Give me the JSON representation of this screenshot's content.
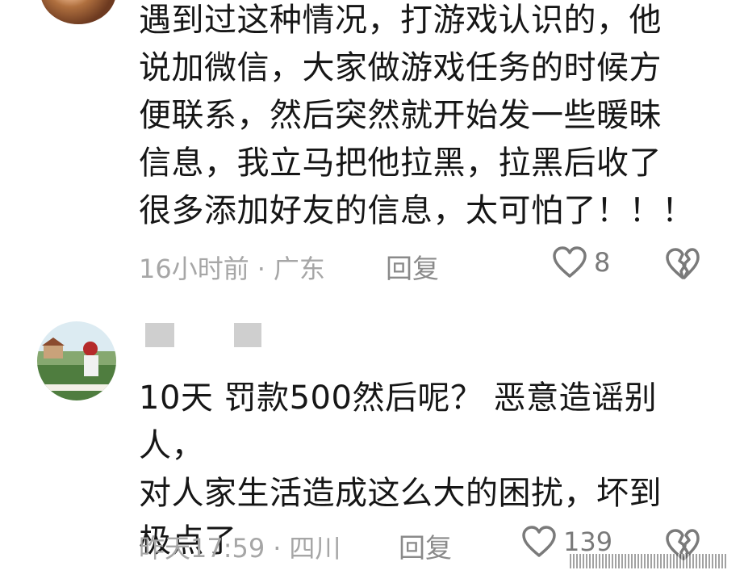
{
  "comments": [
    {
      "text_lines": [
        "遇到过这种情况，打游戏认识的，他",
        "说加微信，大家做游戏任务的时候方",
        "便联系，然后突然就开始发一些暖昧",
        "信息，我立马把他拉黑，拉黑后收了",
        "很多添加好友的信息，太可怕了！！！"
      ],
      "time": "16小时前",
      "separator": "·",
      "location": "广东",
      "reply_label": "回复",
      "likes": "8",
      "icons": {
        "like": "heart-outline-icon",
        "dislike": "broken-heart-icon"
      }
    },
    {
      "text_lines": [
        "10天 罚款500然后呢？ 恶意造谣别人，",
        "对人家生活造成这么大的困扰，坏到",
        "极点了"
      ],
      "time": "昨天17:59",
      "separator": "·",
      "location": "四川",
      "reply_label": "回复",
      "likes": "139",
      "icons": {
        "like": "heart-outline-icon",
        "dislike": "broken-heart-icon"
      }
    }
  ],
  "colors": {
    "text": "#161616",
    "meta": "#a6a6a6",
    "icon": "#7a7a7a",
    "redaction": "#cfcfcf"
  }
}
